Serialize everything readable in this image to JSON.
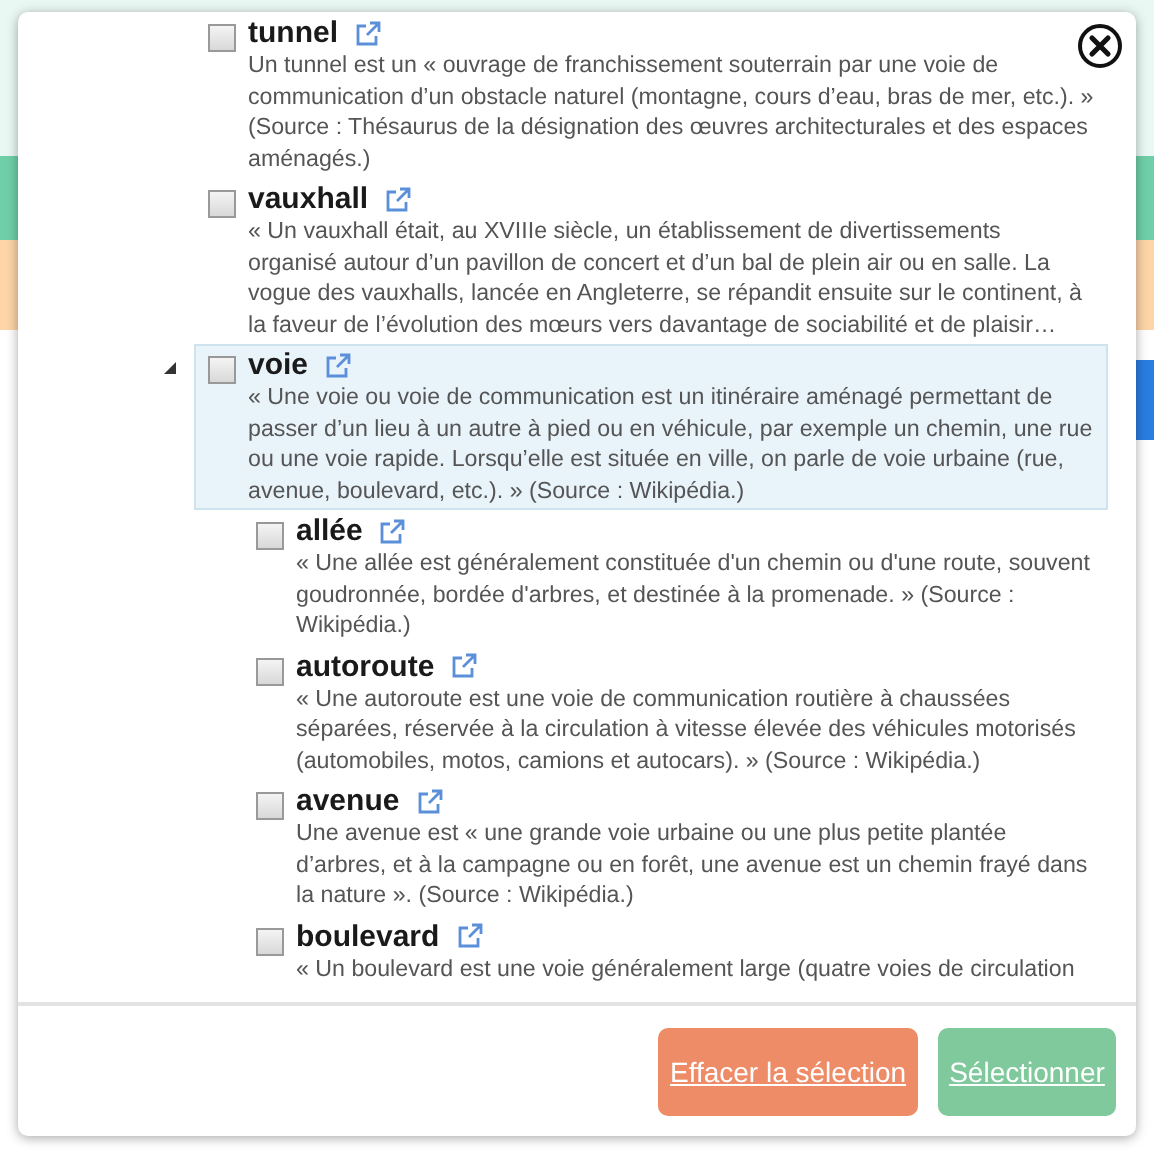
{
  "tree": [
    {
      "title": "tunnel",
      "description": "Un tunnel est un « ouvrage de franchissement souterrain par une voie de communication d’un obstacle naturel (montagne, cours d’eau, bras de mer, etc.). » (Source : Thésaurus de la désignation des œuvres architecturales et des espaces aménagés.)",
      "checked": false,
      "selected": false
    },
    {
      "title": "vauxhall",
      "description": "« Un vauxhall était, au XVIIIe siècle, un établissement de divertissements organisé autour d’un pavillon de concert et d’un bal de plein air ou en salle. La vogue des vauxhalls, lancée en Angleterre, se répandit ensuite sur le continent, à la faveur de l’évolution des mœurs vers davantage de sociabilité et de plaisir…",
      "checked": false,
      "selected": false
    },
    {
      "title": "voie",
      "description": "« Une voie ou voie de communication est un itinéraire aménagé permettant de passer d’un lieu à un autre à pied ou en véhicule, par exemple un chemin, une rue ou une voie rapide. Lorsqu’elle est située en ville, on parle de voie urbaine (rue, avenue, boulevard, etc.). » (Source : Wikipédia.)",
      "checked": false,
      "selected": true,
      "expanded": true,
      "children": [
        {
          "title": "allée",
          "description": "« Une allée est généralement constituée d'un chemin ou d'une route, souvent goudronnée, bordée d'arbres, et destinée à la promenade. » (Source : Wikipédia.)",
          "checked": false,
          "selected": false
        },
        {
          "title": "autoroute",
          "description": "« Une autoroute est une voie de communication routière à chaussées séparées, réservée à la circulation à vitesse élevée des véhicules motorisés (automobiles, motos, camions et autocars). » (Source : Wikipédia.)",
          "checked": false,
          "selected": false
        },
        {
          "title": "avenue",
          "description": "Une avenue est « une grande voie urbaine ou une plus petite plantée d’arbres, et à la campagne ou en forêt, une avenue est un chemin frayé dans la nature ». (Source : Wikipédia.)",
          "checked": false,
          "selected": false
        },
        {
          "title": "boulevard",
          "description": "« Un boulevard est une voie généralement large (quatre voies de circulation",
          "checked": false,
          "selected": false
        }
      ]
    }
  ],
  "buttons": [
    {
      "label": "Effacer la sélection",
      "kind": "clear"
    },
    {
      "label": "Sélectionner",
      "kind": "confirm"
    }
  ]
}
